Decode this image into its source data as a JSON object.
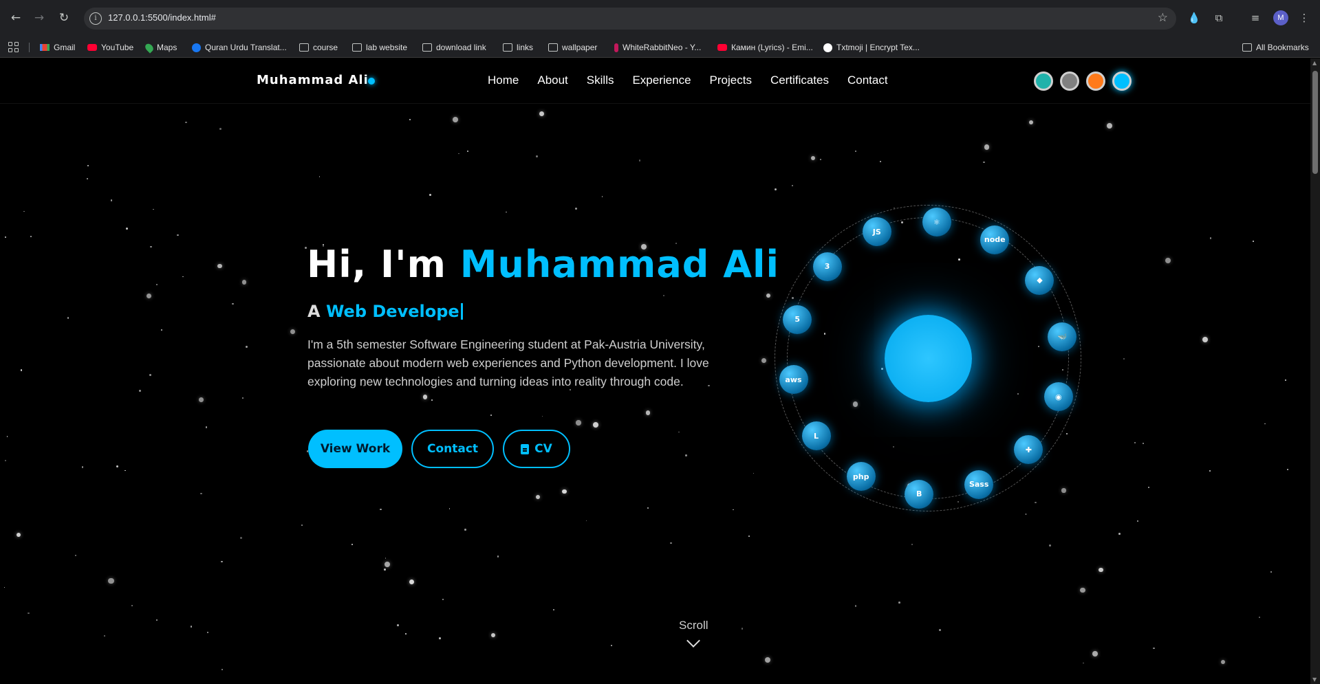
{
  "browser": {
    "url": "127.0.0.1:5500/index.html#",
    "bookmarks": [
      {
        "label": "Gmail",
        "icon": "gmail-icon"
      },
      {
        "label": "YouTube",
        "icon": "youtube-icon"
      },
      {
        "label": "Maps",
        "icon": "maps-icon"
      },
      {
        "label": "Quran Urdu Translat...",
        "icon": "facebook-icon"
      },
      {
        "label": "course",
        "icon": "folder-icon"
      },
      {
        "label": "lab website",
        "icon": "folder-icon"
      },
      {
        "label": "download link",
        "icon": "folder-icon"
      },
      {
        "label": "links",
        "icon": "folder-icon"
      },
      {
        "label": "wallpaper",
        "icon": "folder-icon"
      },
      {
        "label": "WhiteRabbitNeo - Y...",
        "icon": "whiterabbit-icon"
      },
      {
        "label": "Камин (Lyrics) - Emi...",
        "icon": "youtube-icon"
      },
      {
        "label": "Txtmoji | Encrypt Tex...",
        "icon": "txtmoji-icon"
      }
    ],
    "all_bookmarks": "All Bookmarks",
    "profile_initial": "M"
  },
  "site": {
    "logo": "Muhammad Ali",
    "nav": [
      "Home",
      "About",
      "Skills",
      "Experience",
      "Projects",
      "Certificates",
      "Contact"
    ],
    "theme_colors": [
      "#20b2aa",
      "#808080",
      "#ff7a1a",
      "#00bfff"
    ]
  },
  "hero": {
    "greeting": "Hi, I'm ",
    "name": "Muhammad Ali",
    "role_prefix": "A ",
    "role_typed": "Web Develope",
    "intro": "I'm a 5th semester Software Engineering student at Pak-Austria University, passionate about modern web experiences and Python development. I love exploring new technologies and turning ideas into reality through code.",
    "buttons": {
      "view_work": "View Work",
      "contact": "Contact",
      "cv": "CV"
    },
    "accent_color": "#00bfff"
  },
  "orbit_icons": [
    {
      "name": "javascript-icon",
      "glyph": "JS"
    },
    {
      "name": "react-icon",
      "glyph": "⚛"
    },
    {
      "name": "nodejs-icon",
      "glyph": "node"
    },
    {
      "name": "git-icon",
      "glyph": "◆"
    },
    {
      "name": "docker-icon",
      "glyph": "🐳"
    },
    {
      "name": "github-icon",
      "glyph": "◉"
    },
    {
      "name": "python-icon",
      "glyph": "✚"
    },
    {
      "name": "sass-icon",
      "glyph": "Sass"
    },
    {
      "name": "bootstrap-icon",
      "glyph": "B"
    },
    {
      "name": "php-icon",
      "glyph": "php"
    },
    {
      "name": "laravel-icon",
      "glyph": "L"
    },
    {
      "name": "aws-icon",
      "glyph": "aws"
    },
    {
      "name": "html5-icon",
      "glyph": "5"
    },
    {
      "name": "css3-icon",
      "glyph": "3"
    }
  ],
  "scroll": {
    "label": "Scroll"
  }
}
